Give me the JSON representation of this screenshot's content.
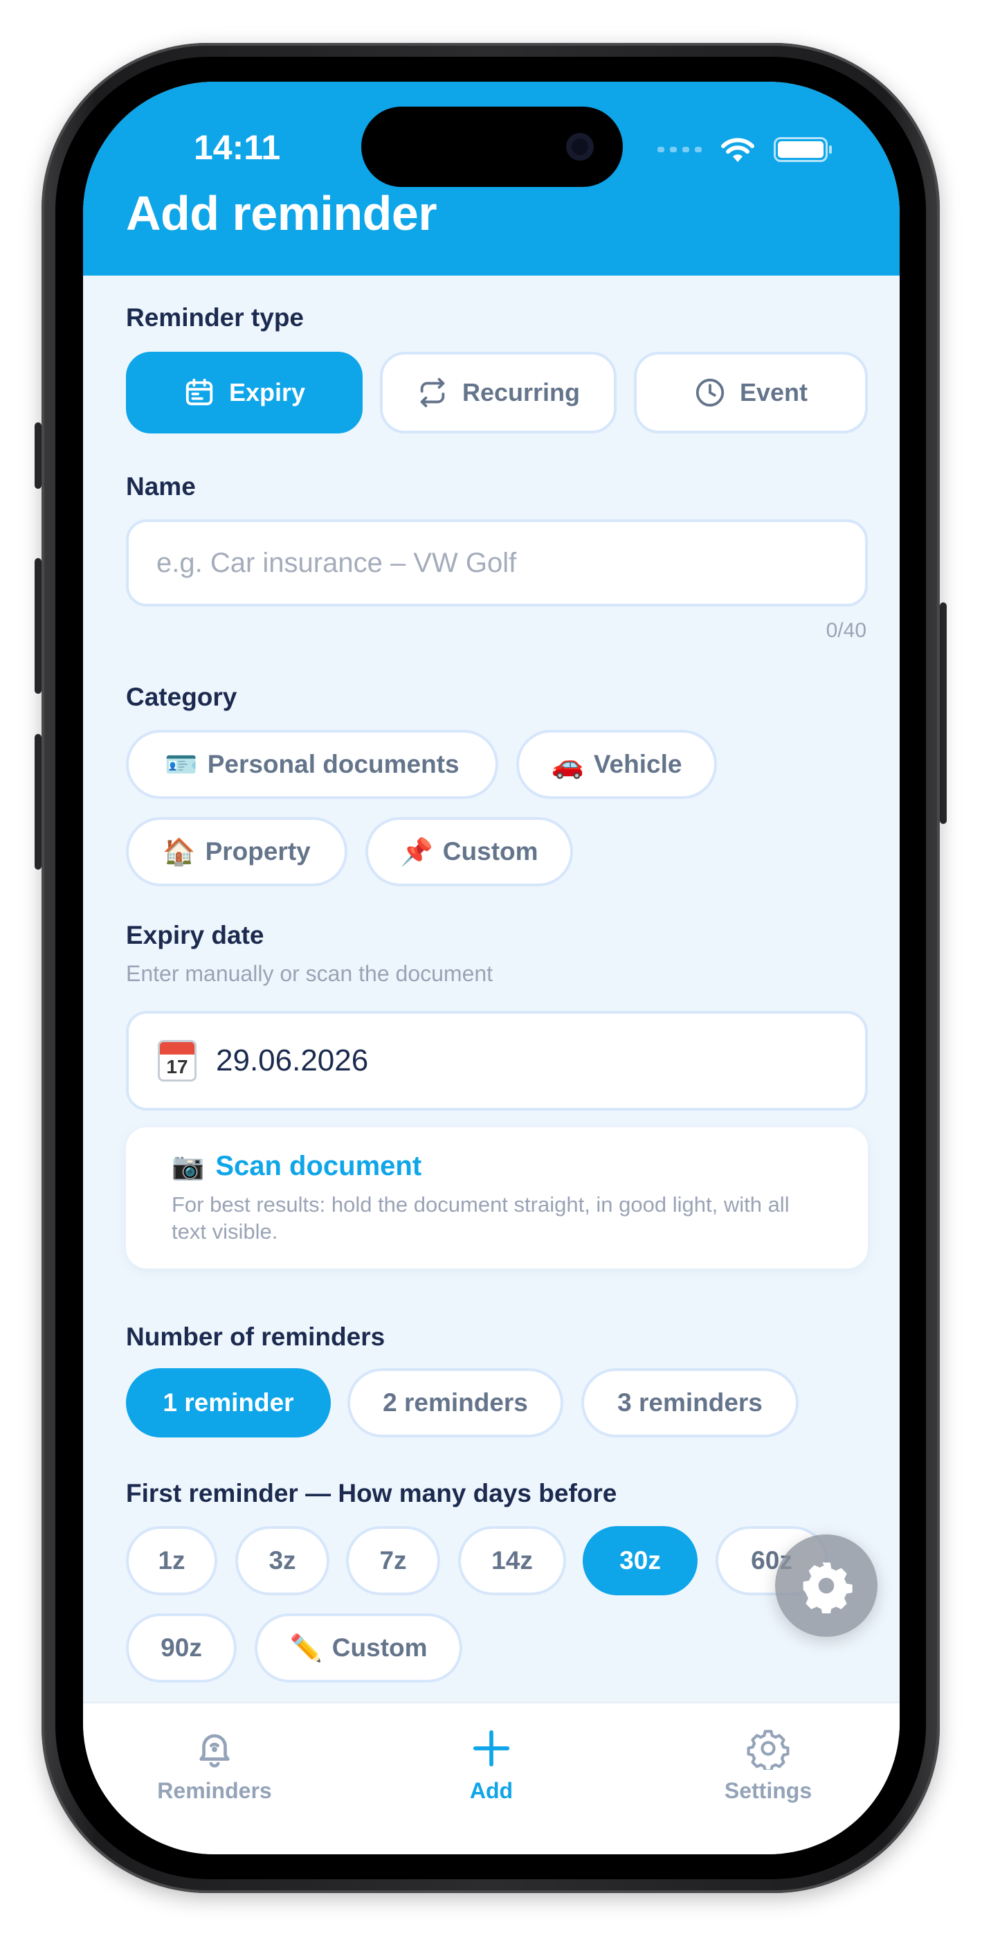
{
  "status_bar": {
    "time": "14:11"
  },
  "header": {
    "title": "Add reminder"
  },
  "reminder_type": {
    "label": "Reminder type",
    "options": [
      {
        "label": "Expiry",
        "icon": "calendar-icon",
        "selected": true
      },
      {
        "label": "Recurring",
        "icon": "repeat-icon",
        "selected": false
      },
      {
        "label": "Event",
        "icon": "clock-icon",
        "selected": false
      }
    ]
  },
  "name": {
    "label": "Name",
    "placeholder": "e.g. Car insurance – VW Golf",
    "value": "",
    "counter": "0/40"
  },
  "category": {
    "label": "Category",
    "options": [
      {
        "emoji": "🪪",
        "label": "Personal documents"
      },
      {
        "emoji": "🚗",
        "label": "Vehicle"
      },
      {
        "emoji": "🏠",
        "label": "Property"
      },
      {
        "emoji": "📌",
        "label": "Custom"
      }
    ]
  },
  "expiry": {
    "label": "Expiry date",
    "hint": "Enter manually or scan the document",
    "calendar_day": "17",
    "value": "29.06.2026"
  },
  "scan": {
    "emoji": "📷",
    "title": "Scan document",
    "description": "For best results: hold the document straight, in good light, with all text visible."
  },
  "reminders_count": {
    "label": "Number of reminders",
    "options": [
      {
        "label": "1 reminder",
        "selected": true
      },
      {
        "label": "2 reminders",
        "selected": false
      },
      {
        "label": "3 reminders",
        "selected": false
      }
    ]
  },
  "first_reminder": {
    "label": "First reminder — How many days before",
    "options": [
      {
        "label": "1z",
        "selected": false
      },
      {
        "label": "3z",
        "selected": false
      },
      {
        "label": "7z",
        "selected": false
      },
      {
        "label": "14z",
        "selected": false
      },
      {
        "label": "30z",
        "selected": true
      },
      {
        "label": "60z",
        "selected": false
      },
      {
        "label": "90z",
        "selected": false
      },
      {
        "label": "Custom",
        "emoji": "✏️",
        "selected": false
      }
    ]
  },
  "tabbar": {
    "items": [
      {
        "label": "Reminders",
        "icon": "bell-icon",
        "active": false
      },
      {
        "label": "Add",
        "icon": "plus-icon",
        "active": true
      },
      {
        "label": "Settings",
        "icon": "gear-icon",
        "active": false
      }
    ]
  },
  "colors": {
    "accent": "#0ea5e9",
    "background": "#eef6fd",
    "heading": "#1b2a4e",
    "muted": "#64748b"
  }
}
